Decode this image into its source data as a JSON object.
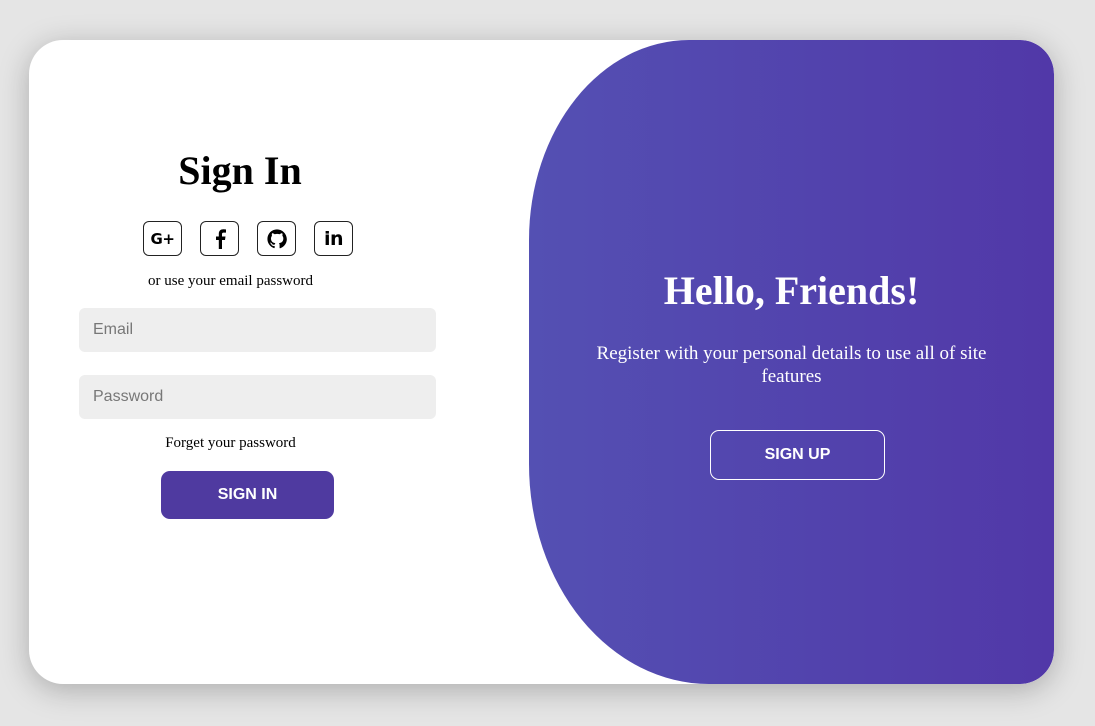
{
  "sign_in": {
    "title": "Sign In",
    "social": [
      {
        "name": "google-plus-icon",
        "label": "G+"
      },
      {
        "name": "facebook-icon",
        "label": ""
      },
      {
        "name": "github-icon",
        "label": ""
      },
      {
        "name": "linkedin-icon",
        "label": "in"
      }
    ],
    "subtext": "or use your email password",
    "email_placeholder": "Email",
    "password_placeholder": "Password",
    "forgot": "Forget your password",
    "button": "SIGN IN"
  },
  "sign_up_panel": {
    "title": "Hello, Friends!",
    "description": "Register with your personal details to use all of site features",
    "button": "SIGN UP"
  },
  "colors": {
    "accent": "#4f3aa0",
    "panel_start": "#5450b3",
    "panel_end": "#5138a8",
    "input_bg": "#eeeeee"
  }
}
